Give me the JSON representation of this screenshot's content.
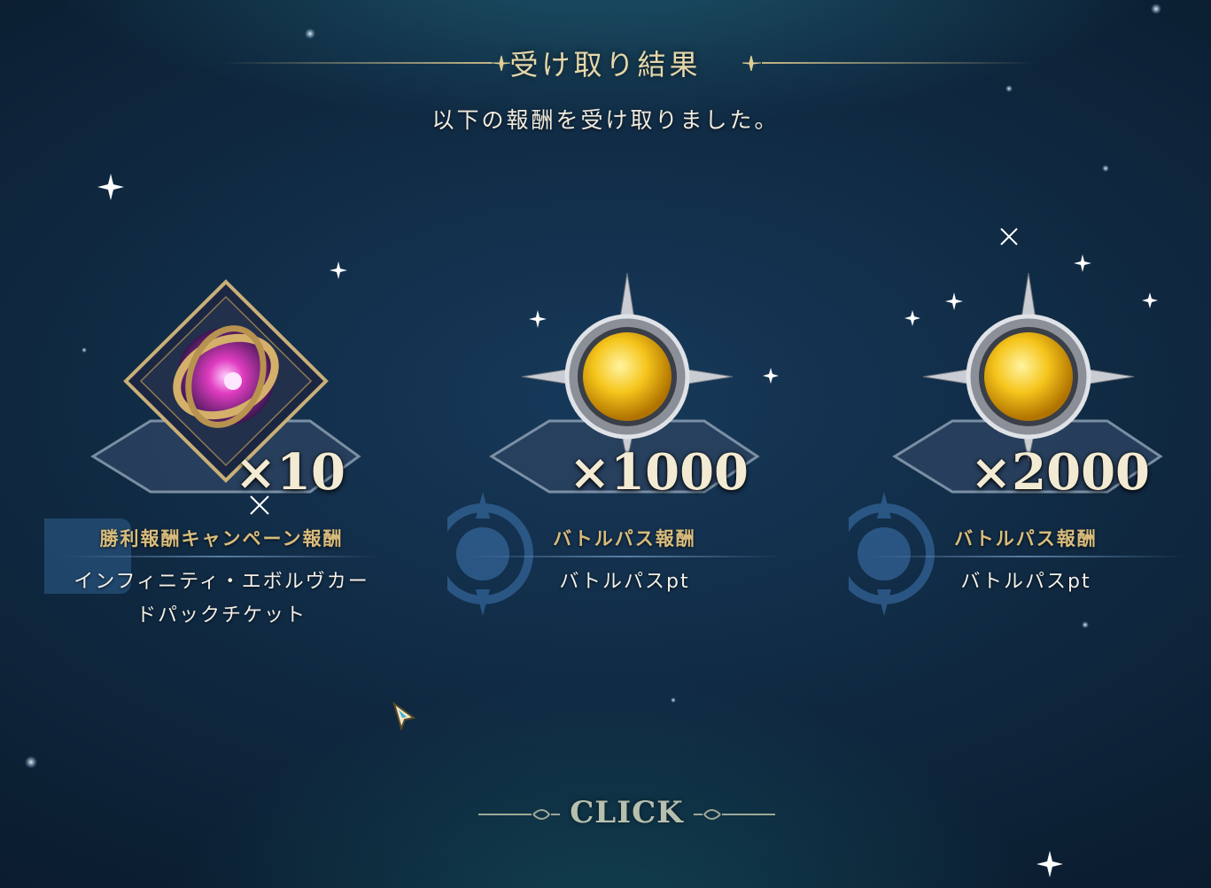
{
  "dialog": {
    "title": "受け取り結果",
    "subtitle": "以下の報酬を受け取りました。"
  },
  "rewards": [
    {
      "quantity": "×10",
      "category": "勝利報酬キャンペーン報酬",
      "name_line1": "インフィニティ・エボルヴカー",
      "name_line2": "ドパックチケット",
      "icon": "ticket-pack-icon"
    },
    {
      "quantity": "×1000",
      "category": "バトルパス報酬",
      "name_line1": "バトルパスpt",
      "icon": "battle-pass-orb-icon"
    },
    {
      "quantity": "×2000",
      "category": "バトルパス報酬",
      "name_line1": "バトルパスpt",
      "icon": "battle-pass-orb-icon"
    }
  ],
  "footer": {
    "click_label": "CLICK"
  },
  "colors": {
    "gold": "#e6d7a9",
    "category_gold": "#d9bc7c",
    "orb_yellow": "#f5c51c",
    "background_navy": "#0f2840"
  }
}
